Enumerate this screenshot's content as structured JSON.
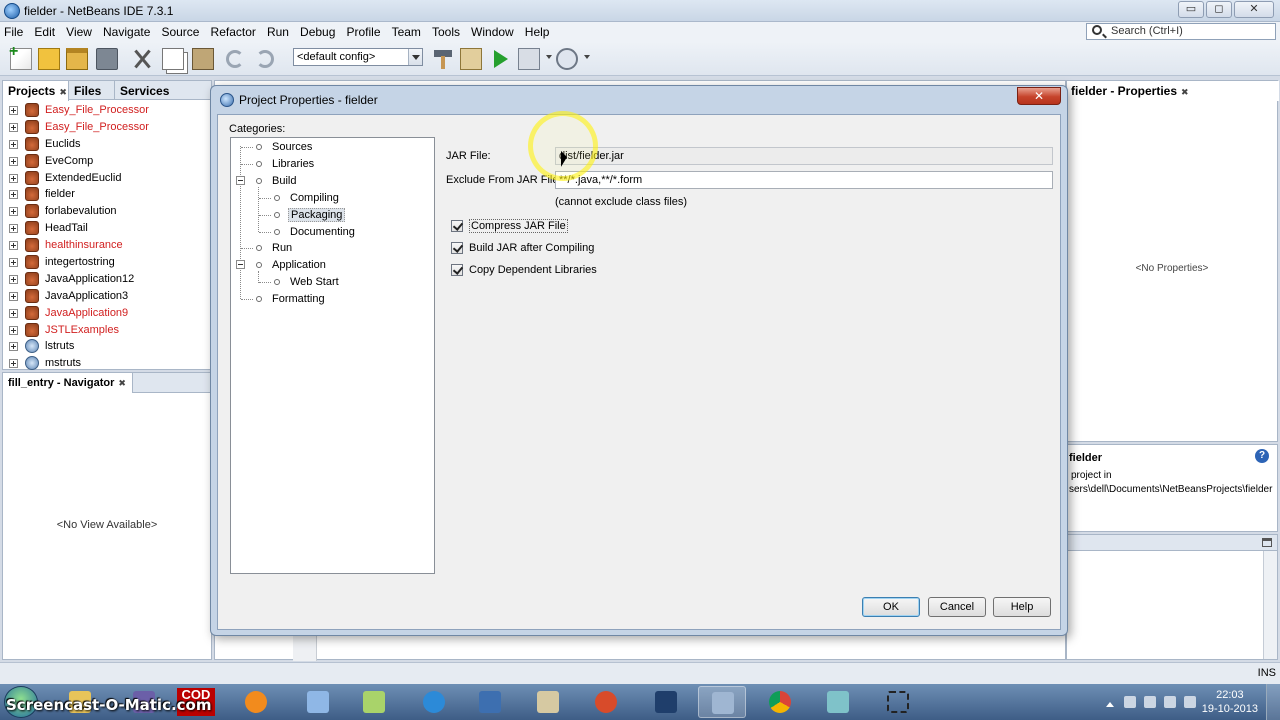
{
  "window": {
    "title": "fielder - NetBeans IDE 7.3.1",
    "min_glyph": "▭",
    "max_glyph": "◻",
    "close_glyph": "✕"
  },
  "menu": [
    "File",
    "Edit",
    "View",
    "Navigate",
    "Source",
    "Refactor",
    "Run",
    "Debug",
    "Profile",
    "Team",
    "Tools",
    "Window",
    "Help"
  ],
  "search": {
    "placeholder": "Search (Ctrl+I)"
  },
  "toolbar": {
    "config": "<default config>"
  },
  "projects_panel": {
    "tabs": [
      "Projects",
      "Files",
      "Services"
    ],
    "items": [
      {
        "label": "Easy_File_Processor",
        "error": true,
        "web": false
      },
      {
        "label": "Easy_File_Processor",
        "error": true,
        "web": false
      },
      {
        "label": "Euclids",
        "error": false,
        "web": false
      },
      {
        "label": "EveComp",
        "error": false,
        "web": false
      },
      {
        "label": "ExtendedEuclid",
        "error": false,
        "web": false
      },
      {
        "label": "fielder",
        "error": false,
        "web": false
      },
      {
        "label": "forlabevalution",
        "error": false,
        "web": false
      },
      {
        "label": "HeadTail",
        "error": false,
        "web": false
      },
      {
        "label": "healthinsurance",
        "error": true,
        "web": false
      },
      {
        "label": "integertostring",
        "error": false,
        "web": false
      },
      {
        "label": "JavaApplication12",
        "error": false,
        "web": false
      },
      {
        "label": "JavaApplication3",
        "error": false,
        "web": false
      },
      {
        "label": "JavaApplication9",
        "error": true,
        "web": false
      },
      {
        "label": "JSTLExamples",
        "error": true,
        "web": false
      },
      {
        "label": "lstruts",
        "error": false,
        "web": true
      },
      {
        "label": "mstruts",
        "error": false,
        "web": true
      }
    ]
  },
  "navigator_panel": {
    "title": "fill_entry - Navigator",
    "empty_text": "<No View Available>"
  },
  "properties_panel": {
    "title": "fielder - Properties",
    "empty_text": "<No Properties>"
  },
  "info_panel": {
    "title": "fielder",
    "line1": "project in",
    "line2": "sers\\dell\\Documents\\NetBeansProjects\\fielder",
    "help_glyph": "?"
  },
  "statusbar": {
    "mode": "INS"
  },
  "dialog": {
    "title": "Project Properties - fielder",
    "close_glyph": "✕",
    "categories_label": "Categories:",
    "categories": {
      "sources": "Sources",
      "libraries": "Libraries",
      "build": "Build",
      "compiling": "Compiling",
      "packaging": "Packaging",
      "documenting": "Documenting",
      "run": "Run",
      "application": "Application",
      "web_start": "Web Start",
      "formatting": "Formatting"
    },
    "selected_category": "Packaging",
    "jar_file_label": "JAR File:",
    "jar_file_value": "dist/fielder.jar",
    "exclude_label": "Exclude From JAR File:",
    "exclude_value": "**/*.java,**/*.form",
    "exclude_hint": "(cannot exclude class files)",
    "checkboxes": {
      "compress": {
        "label": "Compress JAR File",
        "checked": true
      },
      "build_after": {
        "label": "Build JAR after Compiling",
        "checked": true
      },
      "copy_libs": {
        "label": "Copy Dependent Libraries",
        "checked": true
      }
    },
    "buttons": {
      "ok": "OK",
      "cancel": "Cancel",
      "help": "Help"
    }
  },
  "taskbar": {
    "watermark": "Screencast-O-Matic.com",
    "cod_label": "COD",
    "time": "22:03",
    "date": "19-10-2013"
  }
}
